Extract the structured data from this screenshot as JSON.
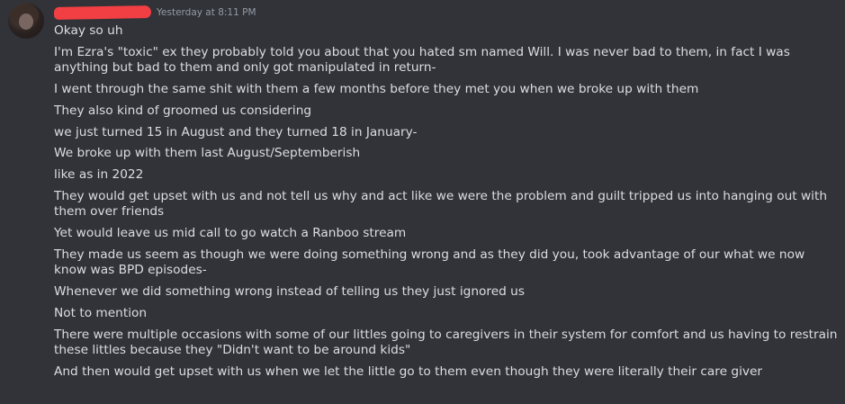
{
  "message": {
    "timestamp": "Yesterday at 8:11 PM",
    "lines": [
      "Okay so uh",
      "I'm Ezra's \"toxic\" ex they probably told you about that you hated sm named Will. I was never bad to them, in fact I was anything but bad to them and only got manipulated in return-",
      "I went through the same shit with them a few months before they met you when we broke up with them",
      "They also kind of groomed us considering",
      "we just turned 15 in August and they turned 18 in January-",
      "We broke up with them last August/Septemberish",
      "like as in 2022",
      "They would get upset with us and not tell us why and act like we were the problem and guilt tripped us into hanging out with them over friends",
      "Yet would leave us mid call to go watch a Ranboo stream",
      "They made us seem as though we were doing something wrong and as they did you, took advantage of our what we now know was BPD episodes-",
      "Whenever we did something wrong instead of telling us they just ignored us",
      "Not to mention",
      "There were multiple occasions with some of our littles going to caregivers in their system for comfort and us having to restrain these littles because they \"Didn't want to be around kids\"",
      "And then would get upset with us when we let the little go to them even though they were literally their care giver"
    ]
  },
  "colors": {
    "background": "#313338",
    "text": "#dbdee1",
    "timestamp": "#949ba4",
    "redaction": "#f23f43"
  }
}
